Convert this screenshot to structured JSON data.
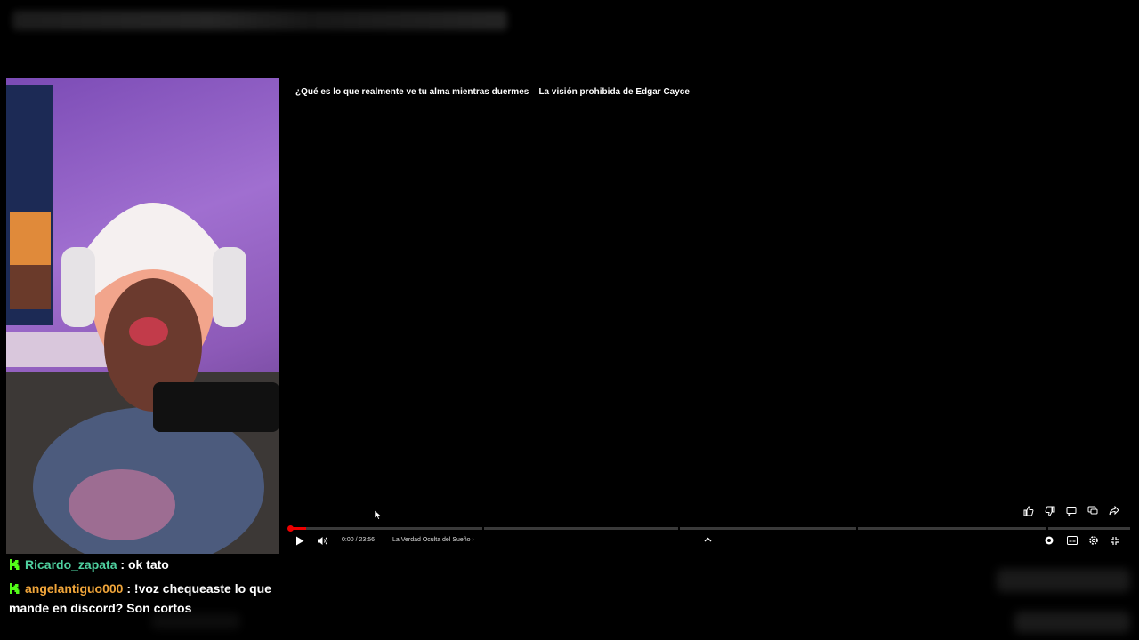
{
  "video": {
    "title": "¿Qué es lo que realmente ve tu alma mientras duermes – La visión prohibida de Edgar Cayce",
    "time": "0:00 / 23:56",
    "chapter": "La Verdad Oculta del Sueño",
    "progress_fraction": 0.0
  },
  "chat": {
    "messages": [
      {
        "username": "Ricardo_zapata",
        "separator": " : ",
        "text": "ok tato"
      },
      {
        "username": "angelantiguo000",
        "separator": " : ",
        "text": "!voz chequeaste lo que mande en discord? Son cortos"
      }
    ]
  },
  "colors": {
    "progress": "#ee0000",
    "user1": "#4fd1a0",
    "user2": "#f0a53a",
    "badge": "#53fc18"
  },
  "icons": [
    "like-icon",
    "dislike-icon",
    "comment-icon",
    "chat-icon",
    "share-icon",
    "play-icon",
    "volume-icon",
    "chevron-up-icon",
    "autoplay-icon",
    "subtitles-icon",
    "settings-icon",
    "exit-fullscreen-icon",
    "cursor-icon"
  ]
}
